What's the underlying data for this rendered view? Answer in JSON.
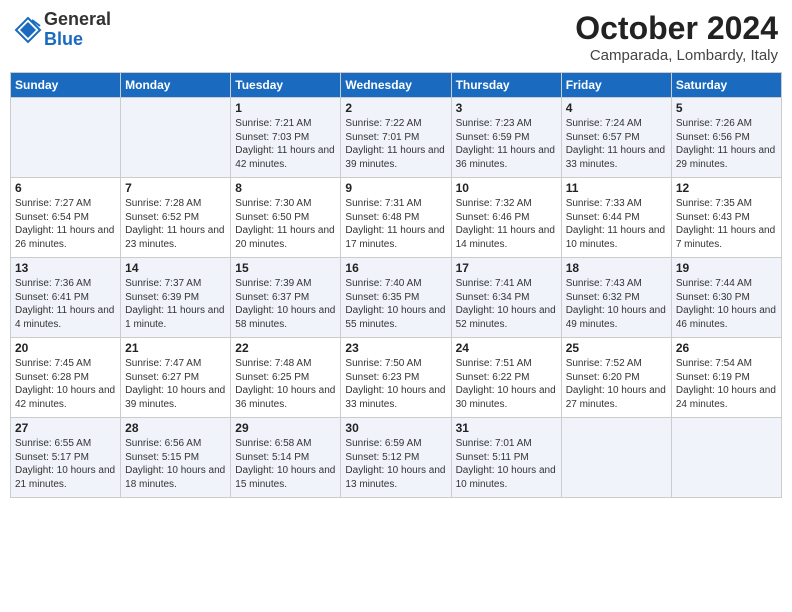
{
  "header": {
    "logo_general": "General",
    "logo_blue": "Blue",
    "month_title": "October 2024",
    "location": "Camparada, Lombardy, Italy"
  },
  "days_of_week": [
    "Sunday",
    "Monday",
    "Tuesday",
    "Wednesday",
    "Thursday",
    "Friday",
    "Saturday"
  ],
  "weeks": [
    [
      {
        "day": "",
        "info": ""
      },
      {
        "day": "",
        "info": ""
      },
      {
        "day": "1",
        "info": "Sunrise: 7:21 AM\nSunset: 7:03 PM\nDaylight: 11 hours and 42 minutes."
      },
      {
        "day": "2",
        "info": "Sunrise: 7:22 AM\nSunset: 7:01 PM\nDaylight: 11 hours and 39 minutes."
      },
      {
        "day": "3",
        "info": "Sunrise: 7:23 AM\nSunset: 6:59 PM\nDaylight: 11 hours and 36 minutes."
      },
      {
        "day": "4",
        "info": "Sunrise: 7:24 AM\nSunset: 6:57 PM\nDaylight: 11 hours and 33 minutes."
      },
      {
        "day": "5",
        "info": "Sunrise: 7:26 AM\nSunset: 6:56 PM\nDaylight: 11 hours and 29 minutes."
      }
    ],
    [
      {
        "day": "6",
        "info": "Sunrise: 7:27 AM\nSunset: 6:54 PM\nDaylight: 11 hours and 26 minutes."
      },
      {
        "day": "7",
        "info": "Sunrise: 7:28 AM\nSunset: 6:52 PM\nDaylight: 11 hours and 23 minutes."
      },
      {
        "day": "8",
        "info": "Sunrise: 7:30 AM\nSunset: 6:50 PM\nDaylight: 11 hours and 20 minutes."
      },
      {
        "day": "9",
        "info": "Sunrise: 7:31 AM\nSunset: 6:48 PM\nDaylight: 11 hours and 17 minutes."
      },
      {
        "day": "10",
        "info": "Sunrise: 7:32 AM\nSunset: 6:46 PM\nDaylight: 11 hours and 14 minutes."
      },
      {
        "day": "11",
        "info": "Sunrise: 7:33 AM\nSunset: 6:44 PM\nDaylight: 11 hours and 10 minutes."
      },
      {
        "day": "12",
        "info": "Sunrise: 7:35 AM\nSunset: 6:43 PM\nDaylight: 11 hours and 7 minutes."
      }
    ],
    [
      {
        "day": "13",
        "info": "Sunrise: 7:36 AM\nSunset: 6:41 PM\nDaylight: 11 hours and 4 minutes."
      },
      {
        "day": "14",
        "info": "Sunrise: 7:37 AM\nSunset: 6:39 PM\nDaylight: 11 hours and 1 minute."
      },
      {
        "day": "15",
        "info": "Sunrise: 7:39 AM\nSunset: 6:37 PM\nDaylight: 10 hours and 58 minutes."
      },
      {
        "day": "16",
        "info": "Sunrise: 7:40 AM\nSunset: 6:35 PM\nDaylight: 10 hours and 55 minutes."
      },
      {
        "day": "17",
        "info": "Sunrise: 7:41 AM\nSunset: 6:34 PM\nDaylight: 10 hours and 52 minutes."
      },
      {
        "day": "18",
        "info": "Sunrise: 7:43 AM\nSunset: 6:32 PM\nDaylight: 10 hours and 49 minutes."
      },
      {
        "day": "19",
        "info": "Sunrise: 7:44 AM\nSunset: 6:30 PM\nDaylight: 10 hours and 46 minutes."
      }
    ],
    [
      {
        "day": "20",
        "info": "Sunrise: 7:45 AM\nSunset: 6:28 PM\nDaylight: 10 hours and 42 minutes."
      },
      {
        "day": "21",
        "info": "Sunrise: 7:47 AM\nSunset: 6:27 PM\nDaylight: 10 hours and 39 minutes."
      },
      {
        "day": "22",
        "info": "Sunrise: 7:48 AM\nSunset: 6:25 PM\nDaylight: 10 hours and 36 minutes."
      },
      {
        "day": "23",
        "info": "Sunrise: 7:50 AM\nSunset: 6:23 PM\nDaylight: 10 hours and 33 minutes."
      },
      {
        "day": "24",
        "info": "Sunrise: 7:51 AM\nSunset: 6:22 PM\nDaylight: 10 hours and 30 minutes."
      },
      {
        "day": "25",
        "info": "Sunrise: 7:52 AM\nSunset: 6:20 PM\nDaylight: 10 hours and 27 minutes."
      },
      {
        "day": "26",
        "info": "Sunrise: 7:54 AM\nSunset: 6:19 PM\nDaylight: 10 hours and 24 minutes."
      }
    ],
    [
      {
        "day": "27",
        "info": "Sunrise: 6:55 AM\nSunset: 5:17 PM\nDaylight: 10 hours and 21 minutes."
      },
      {
        "day": "28",
        "info": "Sunrise: 6:56 AM\nSunset: 5:15 PM\nDaylight: 10 hours and 18 minutes."
      },
      {
        "day": "29",
        "info": "Sunrise: 6:58 AM\nSunset: 5:14 PM\nDaylight: 10 hours and 15 minutes."
      },
      {
        "day": "30",
        "info": "Sunrise: 6:59 AM\nSunset: 5:12 PM\nDaylight: 10 hours and 13 minutes."
      },
      {
        "day": "31",
        "info": "Sunrise: 7:01 AM\nSunset: 5:11 PM\nDaylight: 10 hours and 10 minutes."
      },
      {
        "day": "",
        "info": ""
      },
      {
        "day": "",
        "info": ""
      }
    ]
  ]
}
